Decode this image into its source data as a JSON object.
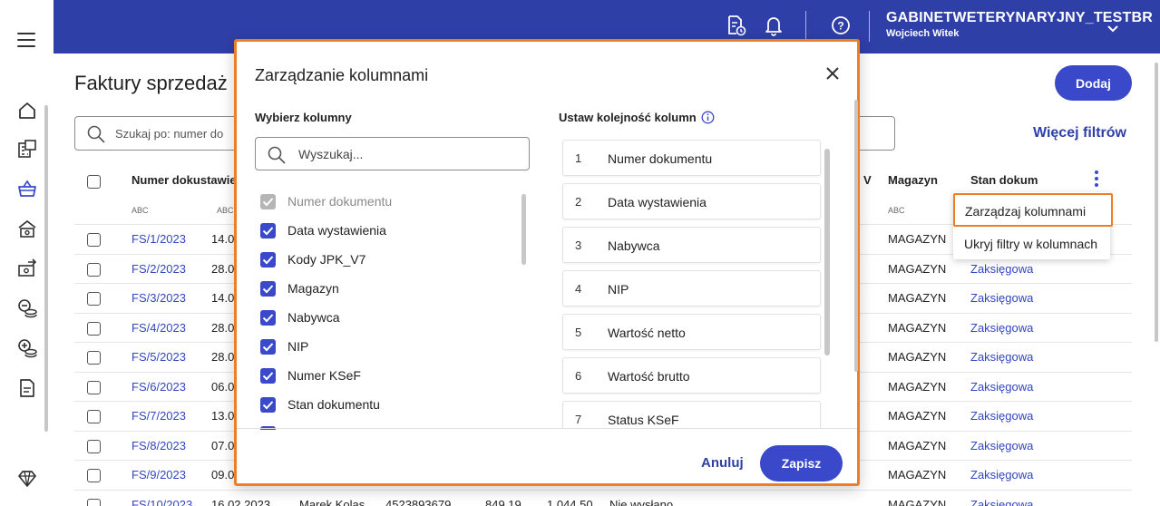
{
  "topbar": {
    "company": "GABINETWETERYNARYJNY_TESTBR",
    "user": "Wojciech Witek"
  },
  "page": {
    "title": "Faktury sprzedaż",
    "search_placeholder": "Szukaj po: numer do",
    "more_filters": "Więcej filtrów",
    "add_label": "Dodaj",
    "columns": {
      "number": "Numer dokustawie",
      "v": "V",
      "warehouse": "Magazyn",
      "status": "Stan dokum"
    },
    "abc_label": "ABC",
    "rows": [
      {
        "number": "FS/1/2023",
        "date": "14.0",
        "warehouse": "MAGAZYN",
        "status": ""
      },
      {
        "number": "FS/2/2023",
        "date": "28.0",
        "warehouse": "MAGAZYN",
        "status": "Zaksięgowa"
      },
      {
        "number": "FS/3/2023",
        "date": "14.0",
        "warehouse": "MAGAZYN",
        "status": "Zaksięgowa"
      },
      {
        "number": "FS/4/2023",
        "date": "28.0",
        "warehouse": "MAGAZYN",
        "status": "Zaksięgowa"
      },
      {
        "number": "FS/5/2023",
        "date": "28.0",
        "warehouse": "MAGAZYN",
        "status": "Zaksięgowa"
      },
      {
        "number": "FS/6/2023",
        "date": "06.0",
        "warehouse": "MAGAZYN",
        "status": "Zaksięgowa"
      },
      {
        "number": "FS/7/2023",
        "date": "13.0",
        "warehouse": "MAGAZYN",
        "status": "Zaksięgowa"
      },
      {
        "number": "FS/8/2023",
        "date": "07.0",
        "warehouse": "MAGAZYN",
        "status": "Zaksięgowa"
      },
      {
        "number": "FS/9/2023",
        "date": "09.0",
        "warehouse": "MAGAZYN",
        "status": "Zaksięgowa"
      },
      {
        "number": "FS/10/2023",
        "date": "16.02.2023",
        "warehouse": "MAGAZYN",
        "status": "Zaksięgowa"
      }
    ],
    "last_row_extra": {
      "buyer": "Marek Kolas",
      "nip": "4523893679",
      "net": "849,19",
      "gross": "1 044,50",
      "ksef": "Nie wysłano"
    }
  },
  "context_menu": {
    "manage_columns": "Zarządzaj kolumnami",
    "hide_filters": "Ukryj filtry w kolumnach"
  },
  "dialog": {
    "title": "Zarządzanie kolumnami",
    "choose_label": "Wybierz kolumny",
    "order_label": "Ustaw kolejność kolumn",
    "search_placeholder": "Wyszukaj...",
    "columns": [
      {
        "label": "Numer dokumentu",
        "checked": true,
        "disabled": true
      },
      {
        "label": "Data wystawienia",
        "checked": true,
        "disabled": false
      },
      {
        "label": "Kody JPK_V7",
        "checked": true,
        "disabled": false
      },
      {
        "label": "Magazyn",
        "checked": true,
        "disabled": false
      },
      {
        "label": "Nabywca",
        "checked": true,
        "disabled": false
      },
      {
        "label": "NIP",
        "checked": true,
        "disabled": false
      },
      {
        "label": "Numer KSeF",
        "checked": true,
        "disabled": false
      },
      {
        "label": "Stan dokumentu",
        "checked": true,
        "disabled": false
      }
    ],
    "order": [
      {
        "num": "1",
        "label": "Numer dokumentu"
      },
      {
        "num": "2",
        "label": "Data wystawienia"
      },
      {
        "num": "3",
        "label": "Nabywca"
      },
      {
        "num": "4",
        "label": "NIP"
      },
      {
        "num": "5",
        "label": "Wartość netto"
      },
      {
        "num": "6",
        "label": "Wartość brutto"
      },
      {
        "num": "7",
        "label": "Status KSeF"
      }
    ],
    "cancel_label": "Anuluj",
    "save_label": "Zapisz"
  },
  "colors": {
    "primary": "#3949c9",
    "topbar": "#2f3fa8",
    "highlight": "#ef7d25",
    "link": "#3246c0"
  }
}
